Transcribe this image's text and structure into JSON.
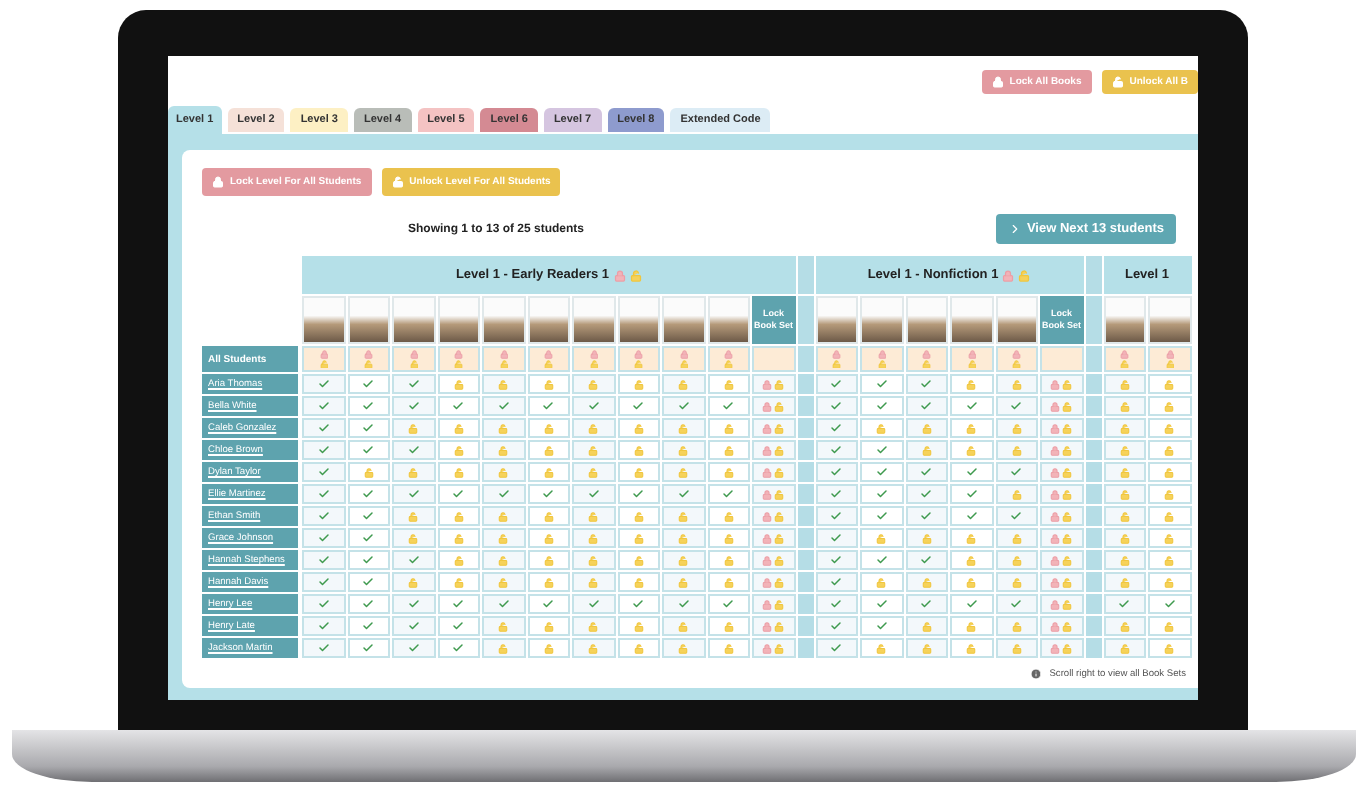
{
  "top_buttons": [
    {
      "kind": "lock",
      "label": "Lock All Books"
    },
    {
      "kind": "unlock",
      "label": "Unlock All B"
    }
  ],
  "tabs": [
    {
      "label": "Level 1",
      "selected": true,
      "color": "#b5e0e8"
    },
    {
      "label": "Level 2",
      "selected": false,
      "color": "#f5e1d8"
    },
    {
      "label": "Level 3",
      "selected": false,
      "color": "#fdf0c4"
    },
    {
      "label": "Level 4",
      "selected": false,
      "color": "#b9bdb8"
    },
    {
      "label": "Level 5",
      "selected": false,
      "color": "#f4c3c3"
    },
    {
      "label": "Level 6",
      "selected": false,
      "color": "#d48a93"
    },
    {
      "label": "Level 7",
      "selected": false,
      "color": "#d5c5e0"
    },
    {
      "label": "Level 8",
      "selected": false,
      "color": "#8e9bce"
    },
    {
      "label": "Extended Code",
      "selected": false,
      "color": "#dcecf5"
    }
  ],
  "level_buttons": [
    {
      "kind": "lock",
      "label": "Lock Level For All Students"
    },
    {
      "kind": "unlock",
      "label": "Unlock Level For All Students"
    }
  ],
  "showing": "Showing 1 to 13 of 25 students",
  "next_button": "View Next 13 students",
  "sets": [
    {
      "title": "Level 1 - Early Readers 1",
      "lock_label": "Lock Book Set"
    },
    {
      "title": "Level 1 - Nonfiction 1",
      "lock_label": "Lock Book Set"
    },
    {
      "title": "Level 1"
    }
  ],
  "all_students_label": "All Students",
  "students": [
    {
      "name": "Aria Thomas",
      "cells": [
        [
          true,
          true,
          true,
          false,
          false,
          false,
          false,
          false,
          false,
          false
        ],
        [
          true,
          true,
          true,
          false,
          false
        ],
        [
          false,
          false
        ]
      ]
    },
    {
      "name": "Bella White",
      "cells": [
        [
          true,
          true,
          true,
          true,
          true,
          true,
          true,
          true,
          true,
          true
        ],
        [
          true,
          true,
          true,
          true,
          true
        ],
        [
          false,
          false
        ]
      ]
    },
    {
      "name": "Caleb Gonzalez",
      "cells": [
        [
          true,
          true,
          false,
          false,
          false,
          false,
          false,
          false,
          false,
          false
        ],
        [
          true,
          false,
          false,
          false,
          false
        ],
        [
          false,
          false
        ]
      ]
    },
    {
      "name": "Chloe Brown",
      "cells": [
        [
          true,
          true,
          true,
          false,
          false,
          false,
          false,
          false,
          false,
          false
        ],
        [
          true,
          true,
          false,
          false,
          false
        ],
        [
          false,
          false
        ]
      ]
    },
    {
      "name": "Dylan Taylor",
      "cells": [
        [
          true,
          false,
          false,
          false,
          false,
          false,
          false,
          false,
          false,
          false
        ],
        [
          true,
          true,
          true,
          true,
          true
        ],
        [
          false,
          false
        ]
      ]
    },
    {
      "name": "Ellie Martinez",
      "cells": [
        [
          true,
          true,
          true,
          true,
          true,
          true,
          true,
          true,
          true,
          true
        ],
        [
          true,
          true,
          true,
          true,
          false
        ],
        [
          false,
          false
        ]
      ]
    },
    {
      "name": "Ethan Smith",
      "cells": [
        [
          true,
          true,
          false,
          false,
          false,
          false,
          false,
          false,
          false,
          false
        ],
        [
          true,
          true,
          true,
          true,
          true
        ],
        [
          false,
          false
        ]
      ]
    },
    {
      "name": "Grace Johnson",
      "cells": [
        [
          true,
          true,
          false,
          false,
          false,
          false,
          false,
          false,
          false,
          false
        ],
        [
          true,
          false,
          false,
          false,
          false
        ],
        [
          false,
          false
        ]
      ]
    },
    {
      "name": "Hannah Stephens",
      "cells": [
        [
          true,
          true,
          true,
          false,
          false,
          false,
          false,
          false,
          false,
          false
        ],
        [
          true,
          true,
          true,
          false,
          false
        ],
        [
          false,
          false
        ]
      ]
    },
    {
      "name": "Hannah Davis",
      "cells": [
        [
          true,
          true,
          false,
          false,
          false,
          false,
          false,
          false,
          false,
          false
        ],
        [
          true,
          false,
          false,
          false,
          false
        ],
        [
          false,
          false
        ]
      ]
    },
    {
      "name": "Henry Lee",
      "cells": [
        [
          true,
          true,
          true,
          true,
          true,
          true,
          true,
          true,
          true,
          true
        ],
        [
          true,
          true,
          true,
          true,
          true
        ],
        [
          true,
          true
        ]
      ]
    },
    {
      "name": "Henry Late",
      "cells": [
        [
          true,
          true,
          true,
          true,
          false,
          false,
          false,
          false,
          false,
          false
        ],
        [
          true,
          true,
          false,
          false,
          false
        ],
        [
          false,
          false
        ]
      ]
    },
    {
      "name": "Jackson Martin",
      "cells": [
        [
          true,
          true,
          true,
          true,
          false,
          false,
          false,
          false,
          false,
          false
        ],
        [
          true,
          false,
          false,
          false,
          false
        ],
        [
          false,
          false
        ]
      ]
    }
  ],
  "scroll_note": "Scroll right to view all Book Sets"
}
